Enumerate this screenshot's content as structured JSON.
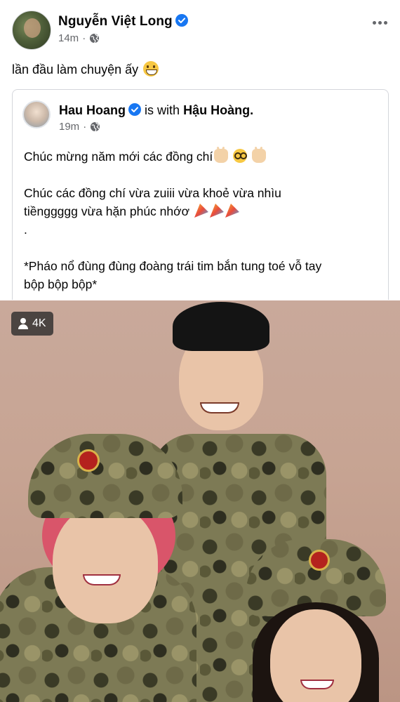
{
  "post": {
    "author": "Nguyễn Việt Long",
    "time": "14m",
    "separator": "·",
    "text": "lần đầu làm chuyện ấy"
  },
  "shared": {
    "author": "Hau Hoang",
    "with_text": "is with",
    "with_name": "Hậu Hoàng.",
    "time": "19m",
    "separator": "·",
    "line1": "Chúc mừng năm mới các đồng chí",
    "line2": "Chúc các đồng chí vừa zuiii vừa khoẻ vừa nhìu",
    "line3": "tiềnggggg vừa hặn phúc nhớơ",
    "line4": ".",
    "line5": "*Pháo nổ đùng đùng đoàng trái tim bắn tung toé vỗ tay",
    "line6": "bộp bộp bộp*"
  },
  "video": {
    "views": "4K"
  },
  "icons": {
    "verified": "verified-badge-icon",
    "privacy": "globe-icon",
    "more": "more-options-icon",
    "viewers": "person-icon"
  },
  "colors": {
    "verified_blue": "#1877f2",
    "meta_gray": "#65676b",
    "text": "#050505"
  }
}
